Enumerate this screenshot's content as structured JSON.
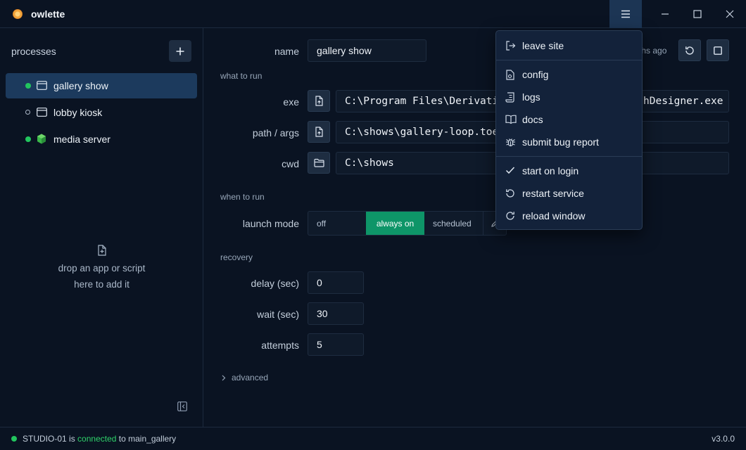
{
  "app": {
    "title": "owlette"
  },
  "sidebar": {
    "title": "processes",
    "items": [
      {
        "label": "gallery show",
        "status": "running"
      },
      {
        "label": "lobby kiosk",
        "status": "stopped"
      },
      {
        "label": "media server",
        "status": "running"
      }
    ],
    "drop_hint_line1": "drop an app or script",
    "drop_hint_line2": "here to add it"
  },
  "form": {
    "name_label": "name",
    "name_value": "gallery show",
    "last_time_suffix": "ths ago",
    "section_what": "what to run",
    "exe_label": "exe",
    "exe_value_left": "C:\\Program Files\\Derivativ",
    "exe_value_right": "hDesigner.exe",
    "path_label": "path / args",
    "path_value": "C:\\shows\\gallery-loop.toe",
    "cwd_label": "cwd",
    "cwd_value": "C:\\shows",
    "section_when": "when to run",
    "launch_label": "launch mode",
    "launch_options": {
      "off": "off",
      "always_on": "always on",
      "scheduled": "scheduled"
    },
    "launch_selected": "always on",
    "section_recovery": "recovery",
    "delay_label": "delay (sec)",
    "delay_value": "0",
    "wait_label": "wait (sec)",
    "wait_value": "30",
    "attempts_label": "attempts",
    "attempts_value": "5",
    "advanced_label": "advanced"
  },
  "menu": {
    "leave_site": "leave site",
    "config": "config",
    "logs": "logs",
    "docs": "docs",
    "submit_bug": "submit bug report",
    "start_on_login": "start on login",
    "restart_service": "restart service",
    "reload_window": "reload window",
    "start_on_login_checked": true
  },
  "status": {
    "machine": "STUDIO-01",
    "is": "is",
    "state": "connected",
    "to": "to",
    "site": "main_gallery",
    "version": "v3.0.0"
  },
  "colors": {
    "accent_green": "#0e9568",
    "status_green": "#22c55e",
    "selected_row": "#1c3a5d"
  }
}
